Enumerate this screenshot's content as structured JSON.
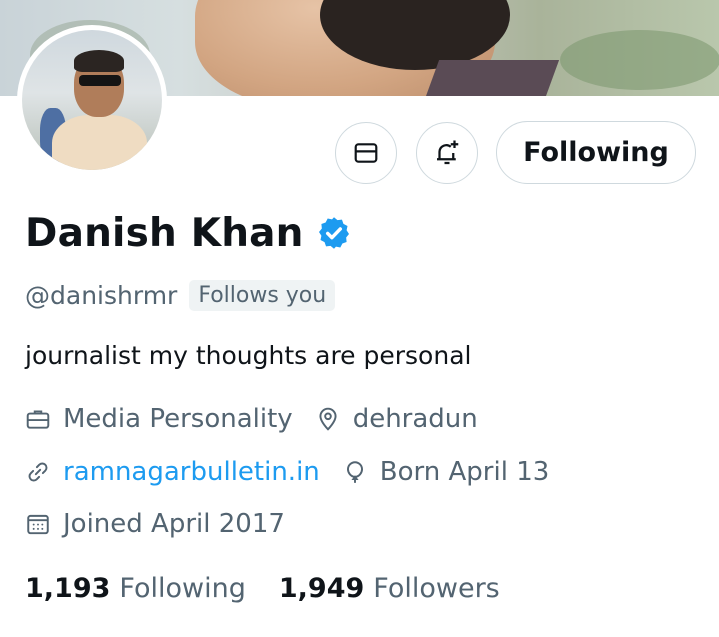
{
  "profile": {
    "name": "Danish Khan",
    "handle": "@danishrmr",
    "follows_you": "Follows you",
    "bio": "journalist my thoughts are personal",
    "category": "Media Personality",
    "location": "dehradun",
    "website": "ramnagarbulletin.in",
    "birthday": "Born April 13",
    "joined": "Joined April 2017"
  },
  "actions": {
    "following_label": "Following",
    "message_icon": "envelope-icon",
    "notify_icon": "bell-plus-icon"
  },
  "stats": {
    "following_count": "1,193",
    "following_label": "Following",
    "followers_count": "1,949",
    "followers_label": "Followers"
  },
  "colors": {
    "verified": "#1d9bf0",
    "link": "#1d9bf0",
    "secondary_text": "#536471"
  }
}
